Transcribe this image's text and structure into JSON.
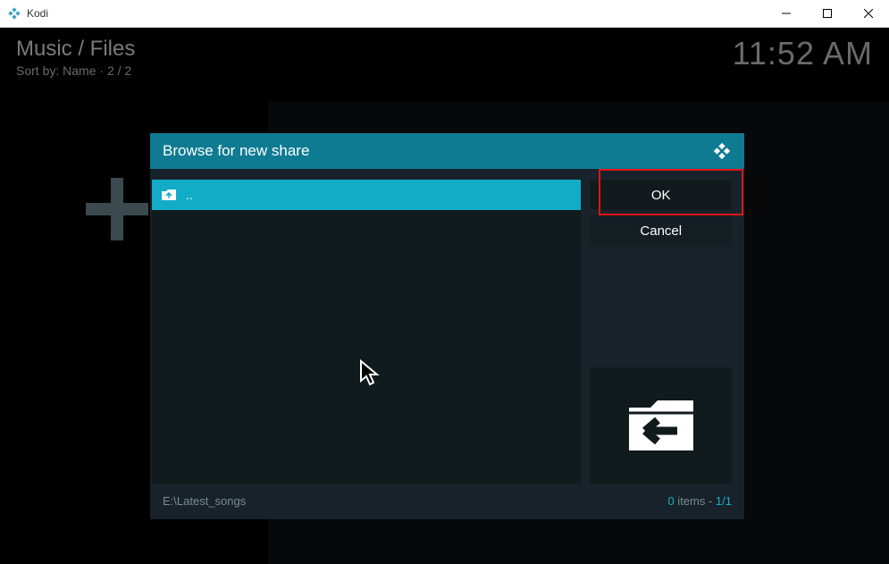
{
  "window": {
    "title": "Kodi"
  },
  "background": {
    "breadcrumb": "Music / Files",
    "sort_label": "Sort by: Name",
    "page_info": "2 / 2",
    "clock": "11:52 AM"
  },
  "dialog": {
    "title": "Browse for new share",
    "list": {
      "items": [
        {
          "label": ".."
        }
      ]
    },
    "buttons": {
      "ok": "OK",
      "cancel": "Cancel"
    },
    "footer": {
      "path": "E:\\Latest_songs",
      "count_value": "0",
      "count_label": " items - ",
      "page": "1/1"
    }
  }
}
